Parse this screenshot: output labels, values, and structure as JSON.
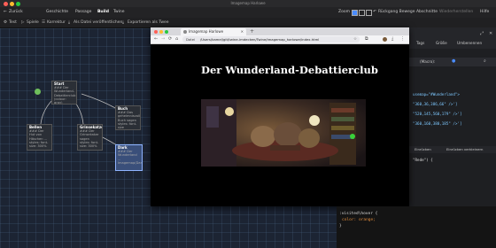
{
  "app": {
    "window_title": "Imagemap Harlowe"
  },
  "menu": {
    "items": [
      {
        "label": "Zurück"
      },
      {
        "label": "Geschichte"
      },
      {
        "label": "Passage"
      },
      {
        "label": "Build",
        "active": true
      },
      {
        "label": "Twine"
      }
    ],
    "zoom_label": "Zoom",
    "right_items": [
      "Rückgang Bewege Abschnitte",
      "Wiederherstellen",
      "Hilfe"
    ]
  },
  "toolbar": {
    "items": [
      "Test",
      "Spiele",
      "Korrektur",
      "Als Datei veröffentlichen",
      "Exportieren als Twee"
    ]
  },
  "passages": [
    {
      "title": "Start",
      "excerpt": "### Der Wunderland-Debattierclub (colour: gray)"
    },
    {
      "title": "Bellen",
      "excerpt": "### Der Hut von Häschen ... styles: font-size: 300%"
    },
    {
      "title": "Grinsekatze",
      "excerpt": "### Der Grinsekatze sagen styles: font-size: 300%"
    },
    {
      "title": "Buch",
      "excerpt": "### Das geheimnisvolle Buch sagen styles: font-size"
    },
    {
      "title": "Dark",
      "excerpt": "### Der Wunderland ... Imagemap(Dark)"
    }
  ],
  "browser": {
    "tab_title": "Imagemap Harlowe",
    "url_scheme": "Datei",
    "url": "/Users/kamel/git/twine-imdecken/Twine/imagemap_harlowe/index.html",
    "heading": "Der Wunderland-Debattierclub"
  },
  "right_panel": {
    "tabs": [
      "Tags",
      "Größe",
      "Umbenennen"
    ],
    "macro_label": "(Macro):",
    "code_lines": [
      "usemap=\"#Wunderland\">",
      "\"360,36,386,66\" />']",
      "\"520,145,560,179\" />']",
      "\"360,160,380,185\" />']"
    ],
    "tool_labels": [
      "Einrücken",
      "Einrücken verkleinern"
    ],
    "code_line2": "\"Rede\") {"
  },
  "css_box": {
    "lines": [
      ":visited\\hover {",
      "color: orange;",
      "}"
    ]
  },
  "colors": {
    "accent": "#4a8cff",
    "canvas": "#1c2433",
    "selected_card": "#3a4f7a",
    "start_node": "#6fbf5c"
  }
}
